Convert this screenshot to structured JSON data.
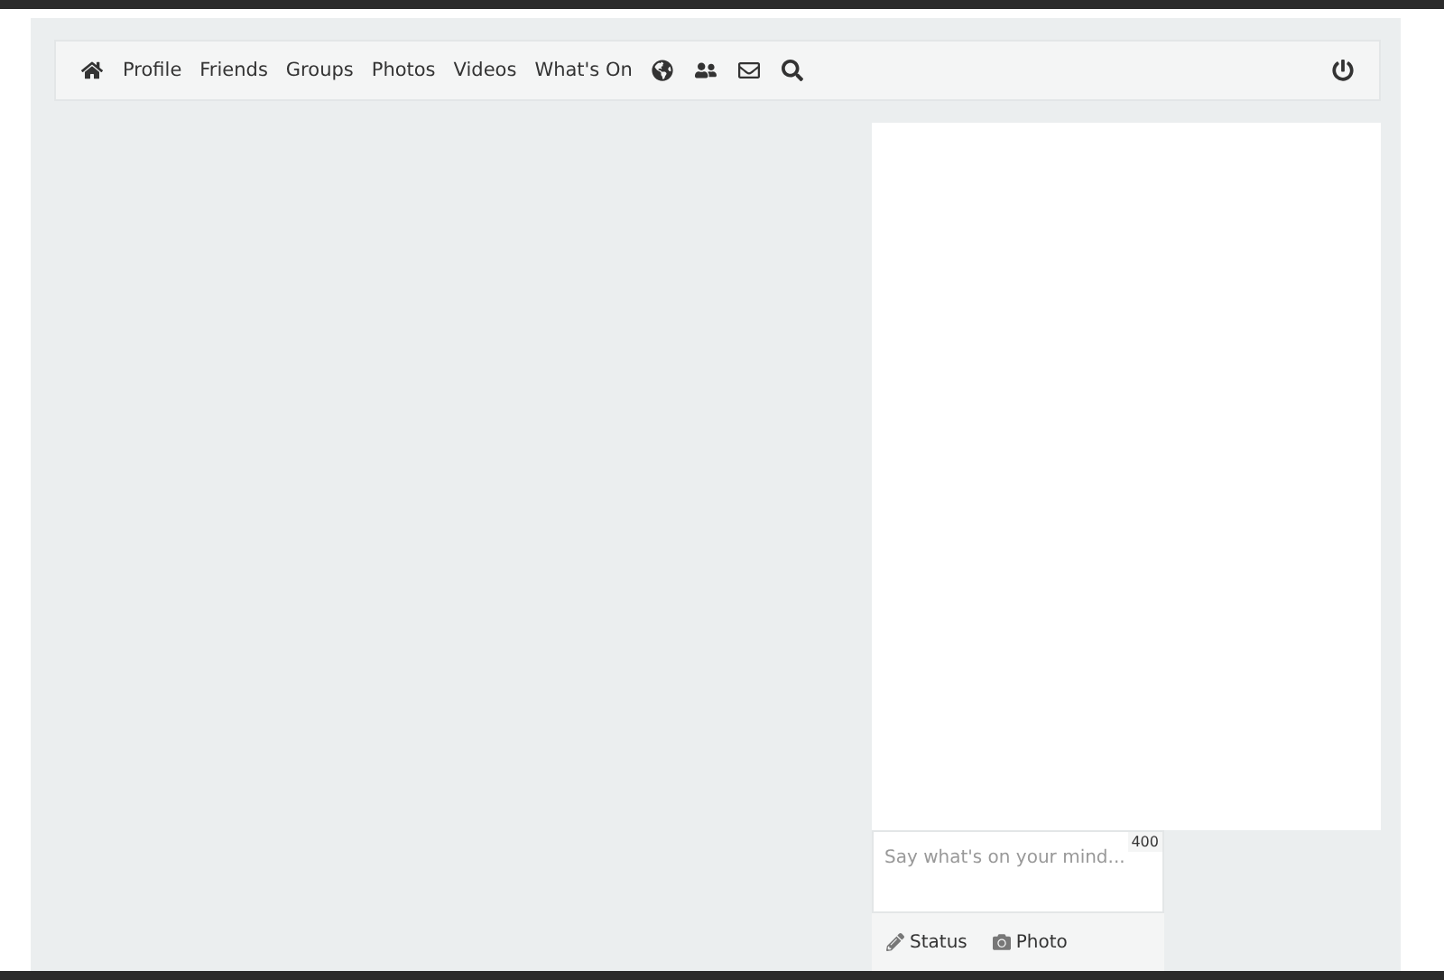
{
  "nav": {
    "links": [
      "Profile",
      "Friends",
      "Groups",
      "Photos",
      "Videos",
      "What's On"
    ]
  },
  "composer": {
    "placeholder": "Say what's on your mind...",
    "counter": "400",
    "actions": [
      {
        "kind": "status",
        "label": "Status"
      },
      {
        "kind": "photo",
        "label": "Photo"
      }
    ]
  }
}
